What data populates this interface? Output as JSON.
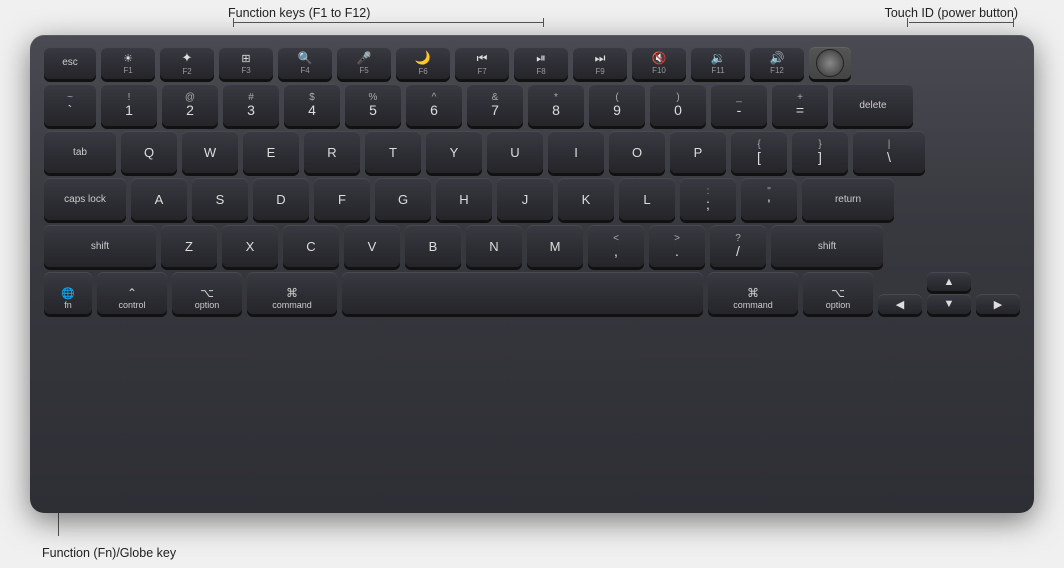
{
  "annotations": {
    "fn_keys_label": "Function keys (F1 to F12)",
    "touchid_label": "Touch ID (power button)",
    "fn_globe_label": "Function (Fn)/Globe key"
  },
  "keyboard": {
    "rows": {
      "fn_row": [
        "esc",
        "F1",
        "F2",
        "F3",
        "F4",
        "F5",
        "F6",
        "F7",
        "F8",
        "F9",
        "F10",
        "F11",
        "F12"
      ],
      "number_row": [
        "`~",
        "1!",
        "2@",
        "3#",
        "4$",
        "5%",
        "6^",
        "7&",
        "8*",
        "9(",
        "0)",
        "-_",
        "=+",
        "delete"
      ],
      "qwerty_row": [
        "tab",
        "Q",
        "W",
        "E",
        "R",
        "T",
        "Y",
        "U",
        "I",
        "O",
        "P",
        "[{",
        "]}",
        "|\\"
      ],
      "asdf_row": [
        "caps lock",
        "A",
        "S",
        "D",
        "F",
        "G",
        "H",
        "J",
        "K",
        "L",
        ";:",
        "\\'",
        "return"
      ],
      "zxcv_row": [
        "shift",
        "Z",
        "X",
        "C",
        "V",
        "B",
        "N",
        "M",
        ",<",
        ".>",
        "/?",
        "shift"
      ],
      "bottom_row": [
        "fn/globe",
        "control",
        "option",
        "command",
        "space",
        "command",
        "option",
        "arrows"
      ]
    }
  }
}
